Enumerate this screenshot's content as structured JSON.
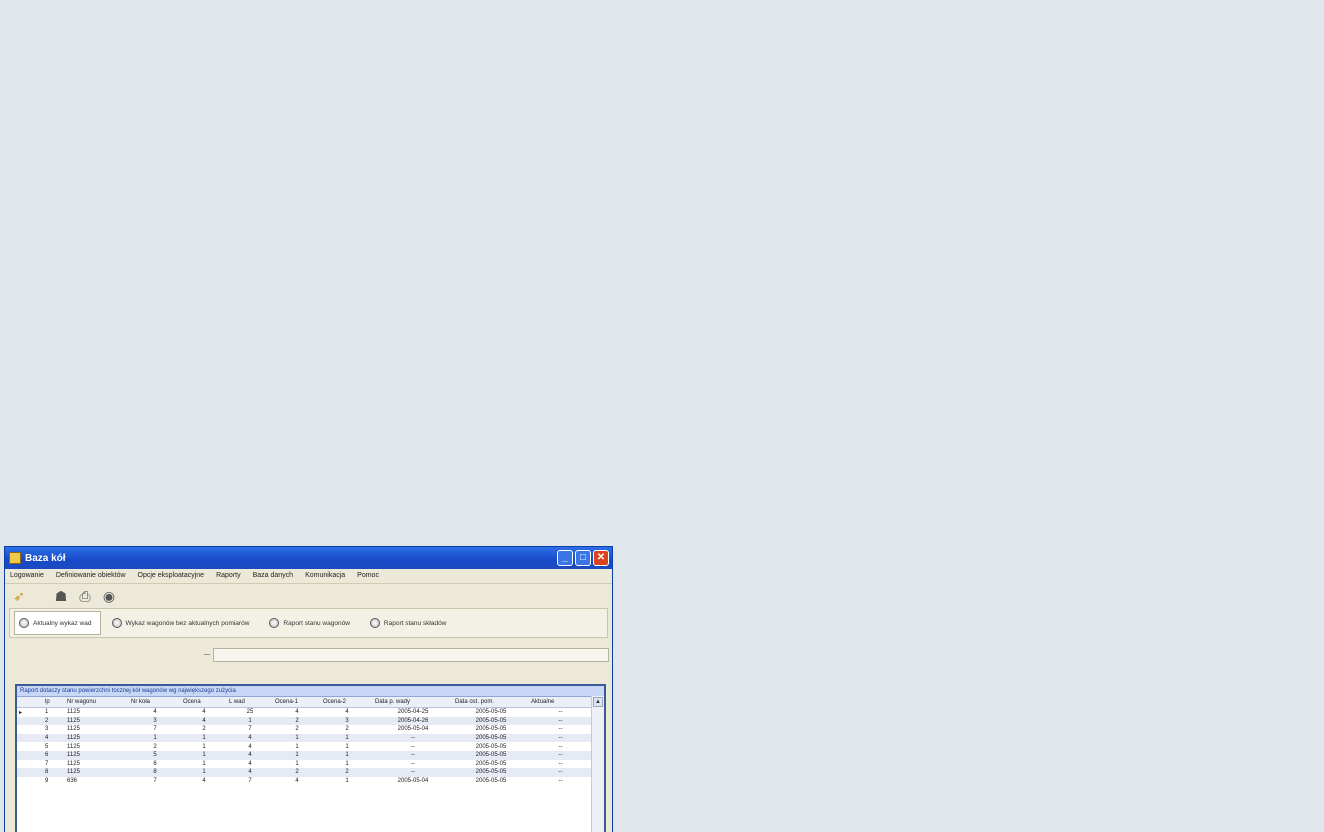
{
  "window": {
    "title": "Baza kół"
  },
  "menu": [
    "Logowanie",
    "Definiowanie obiektów",
    "Opcje eksploatacyjne",
    "Raporty",
    "Baza danych",
    "Komunikacja",
    "Pomoc"
  ],
  "toolbar": [
    "folder-open-icon",
    "user-icon",
    "print-icon",
    "refresh-icon"
  ],
  "tabs": [
    {
      "label": "Aktualny wykaz wad",
      "active": true
    },
    {
      "label": "Wykaz wagonów bez aktualnych pomiarów",
      "active": false
    },
    {
      "label": "Raport stanu wagonów",
      "active": false
    },
    {
      "label": "Raport stanu składów",
      "active": false
    }
  ],
  "grid": {
    "caption": "Raport dotaczy stanu powierzchni tocznej kół wagonów wg największego zużycia",
    "columns": [
      "lp",
      "Nr wagonu",
      "Nr koła",
      "Ocena",
      "L wad",
      "Ocena-1",
      "Ocena-2",
      "Data p. wady",
      "Data ost. pom.",
      "Aktualne"
    ],
    "rows": [
      [
        "1",
        "1125",
        "4",
        "4",
        "25",
        "4",
        "4",
        "2005-04-25",
        "2005-05-05",
        "--"
      ],
      [
        "2",
        "1125",
        "3",
        "4",
        "1",
        "2",
        "3",
        "2005-04-26",
        "2005-05-05",
        "--"
      ],
      [
        "3",
        "1125",
        "7",
        "2",
        "7",
        "2",
        "2",
        "2005-05-04",
        "2005-05-05",
        "--"
      ],
      [
        "4",
        "1125",
        "1",
        "1",
        "4",
        "1",
        "1",
        "--",
        "2005-05-05",
        "--"
      ],
      [
        "5",
        "1125",
        "2",
        "1",
        "4",
        "1",
        "1",
        "--",
        "2005-05-05",
        "--"
      ],
      [
        "6",
        "1125",
        "5",
        "1",
        "4",
        "1",
        "1",
        "--",
        "2005-05-05",
        "--"
      ],
      [
        "7",
        "1125",
        "6",
        "1",
        "4",
        "1",
        "1",
        "--",
        "2005-05-05",
        "--"
      ],
      [
        "8",
        "1125",
        "8",
        "1",
        "4",
        "2",
        "2",
        "--",
        "2005-05-05",
        "--"
      ],
      [
        "9",
        "636",
        "7",
        "4",
        "7",
        "4",
        "1",
        "2005-05-04",
        "2005-05-05",
        "--"
      ]
    ]
  }
}
